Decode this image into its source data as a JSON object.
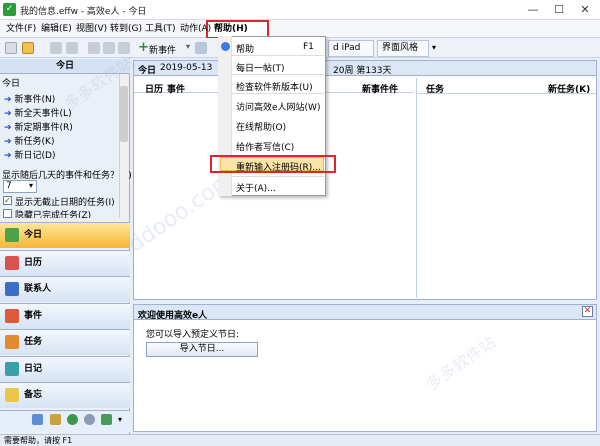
{
  "window": {
    "title": "我的信息.effw - 高效e人 - 今日",
    "controls": [
      "—",
      "☐",
      "✕"
    ]
  },
  "menubar": {
    "items": [
      "文件(F)",
      "编辑(E)",
      "视图(V)",
      "转到(G)",
      "工具(T)",
      "动作(A)",
      "帮助(H)"
    ]
  },
  "toolbar": {
    "new_event_label": "新事件",
    "ipad_label": "d iPad",
    "theme_label": "界面风格"
  },
  "left_panel": {
    "header": "今日",
    "subheader": "今日",
    "links": [
      "新事件(N)",
      "新全天事件(L)",
      "新定期事件(R)",
      "新任务(K)",
      "新日记(D)"
    ],
    "days_question": "显示随后几天的事件和任务？(S)",
    "days_value": "7",
    "check_no_deadline": "显示无截止日期的任务(I)",
    "check_hide_done": "隐藏已完成任务(Z)"
  },
  "nav": {
    "items": [
      "今日",
      "日历",
      "联系人",
      "事件",
      "任务",
      "日记",
      "备忘"
    ],
    "active": "今日"
  },
  "main": {
    "header_label": "今日",
    "header_date": "2019-05-13",
    "header_extra": "20周 第133天",
    "col_calendar": "日历",
    "col_event": "事件",
    "col_new_event": "新事件件",
    "col_task": "任务",
    "col_new_task": "新任务(K)",
    "welcome_title": "欢迎使用高效e人",
    "welcome_text": "您可以导入预定义节日:",
    "import_button": "导入节日..."
  },
  "help_menu": {
    "items": [
      {
        "label": "帮助",
        "shortcut": "F1"
      },
      {
        "label": "每日一帖(T)",
        "shortcut": ""
      },
      {
        "label": "检查软件新版本(U)",
        "shortcut": ""
      },
      {
        "label": "访问高效e人网站(W)",
        "shortcut": ""
      },
      {
        "label": "在线帮助(O)",
        "shortcut": ""
      },
      {
        "label": "给作者写信(C)",
        "shortcut": ""
      },
      {
        "label": "重新输入注册码(R)...",
        "shortcut": ""
      },
      {
        "label": "关于(A)...",
        "shortcut": ""
      }
    ]
  },
  "status": {
    "text": "需要帮助，请按 F1"
  },
  "watermark": {
    "text": "多多软件站",
    "url": "ddooo.com"
  },
  "colors": {
    "highlight_border": "#e0242c",
    "active_nav": "#f5b535",
    "panel_header": "#dbe6f6"
  }
}
